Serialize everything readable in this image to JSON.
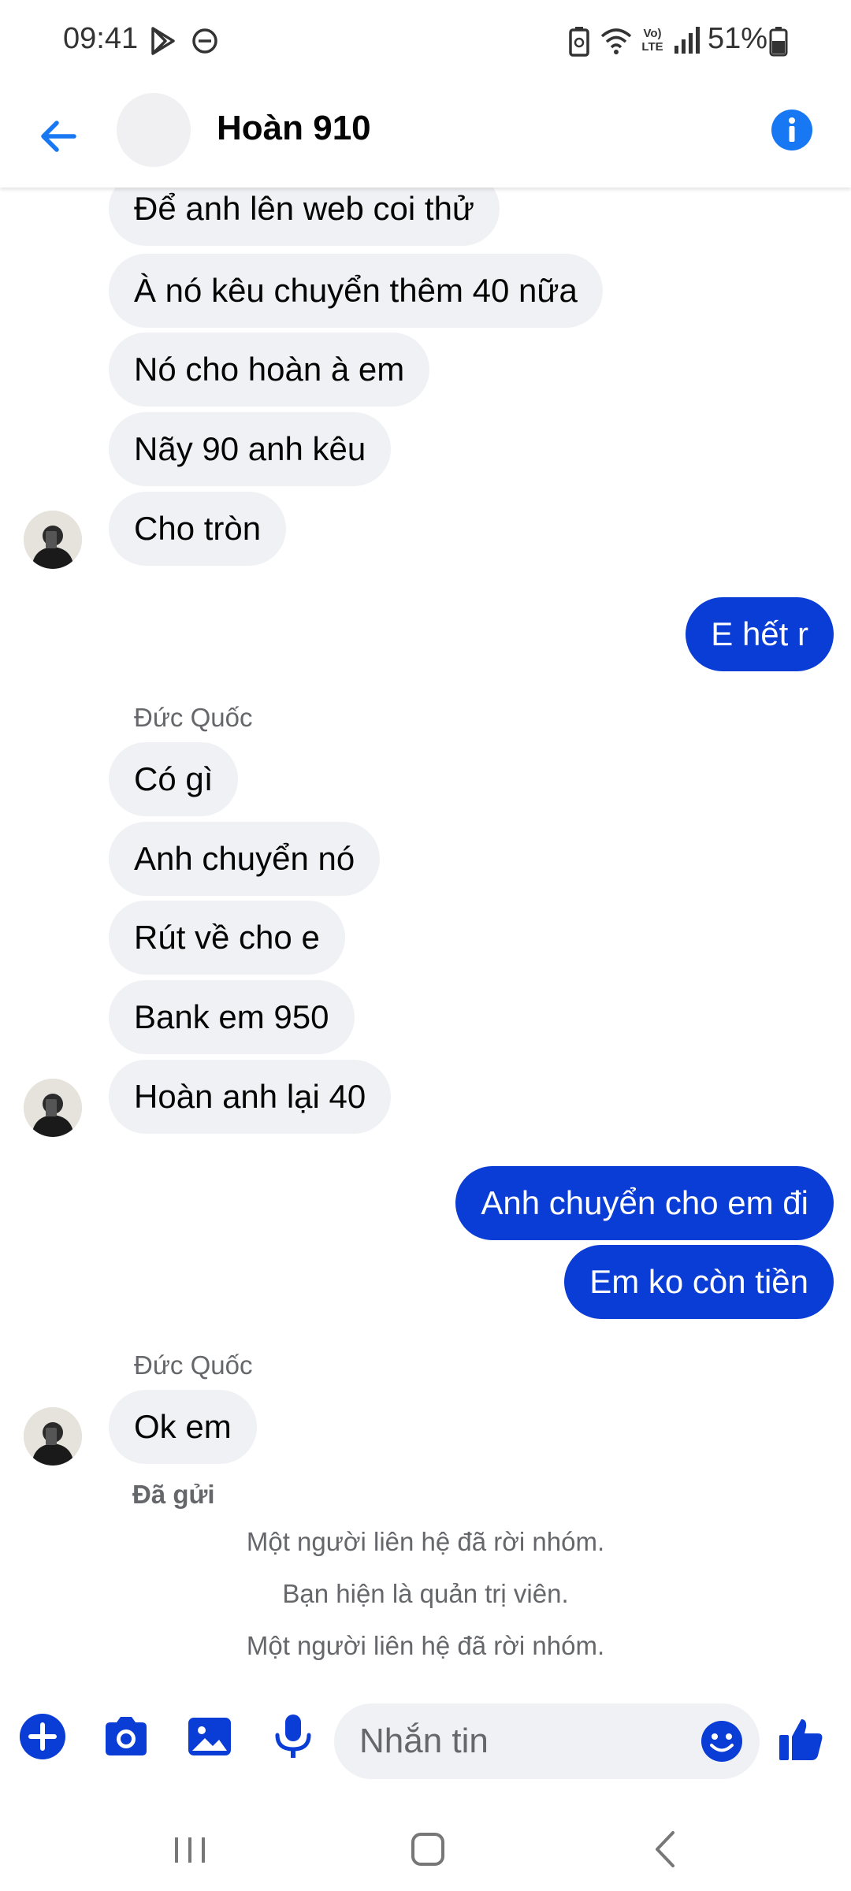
{
  "status_bar": {
    "time": "09:41",
    "battery_percent": "51%",
    "network_label": "Vo) LTE",
    "icons": [
      "play-store-icon",
      "do-not-disturb-icon",
      "battery-saver-icon",
      "wifi-icon",
      "volte-icon",
      "signal-icon",
      "battery-icon"
    ]
  },
  "header": {
    "title": "Hoàn 910",
    "icons": [
      "back-arrow-icon",
      "info-icon"
    ],
    "accent_color": "#1877f2"
  },
  "chat": {
    "group1": [
      "Để anh lên web coi thử",
      "À nó kêu chuyển thêm 40 nữa",
      "Nó cho hoàn à em",
      "Nãy 90 anh kêu",
      "Cho tròn"
    ],
    "out1": "E hết r",
    "group2_sender": "Đức Quốc",
    "group2": [
      "Có gì",
      "Anh chuyển nó",
      "Rút về cho e",
      "Bank em 950",
      "Hoàn anh lại 40"
    ],
    "out2": [
      "Anh chuyển cho em đi",
      "Em ko còn tiền"
    ],
    "group3_sender": "Đức Quốc",
    "group3": [
      "Ok em"
    ],
    "sent_status": "Đã gửi",
    "system_messages": [
      "Một người liên hệ đã rời nhóm.",
      "Bạn hiện là quản trị viên.",
      "Một người liên hệ đã rời nhóm."
    ],
    "incoming_bubble_color": "#f0f1f4",
    "outgoing_bubble_color": "#0a3cd6"
  },
  "composer": {
    "placeholder": "Nhắn tin",
    "icons": [
      "add-icon",
      "camera-icon",
      "gallery-icon",
      "microphone-icon",
      "emoji-icon",
      "thumbs-up-icon"
    ],
    "icon_color": "#0a3cd6"
  },
  "nav_bar": {
    "icons": [
      "recent-apps-icon",
      "home-icon",
      "back-icon"
    ]
  }
}
